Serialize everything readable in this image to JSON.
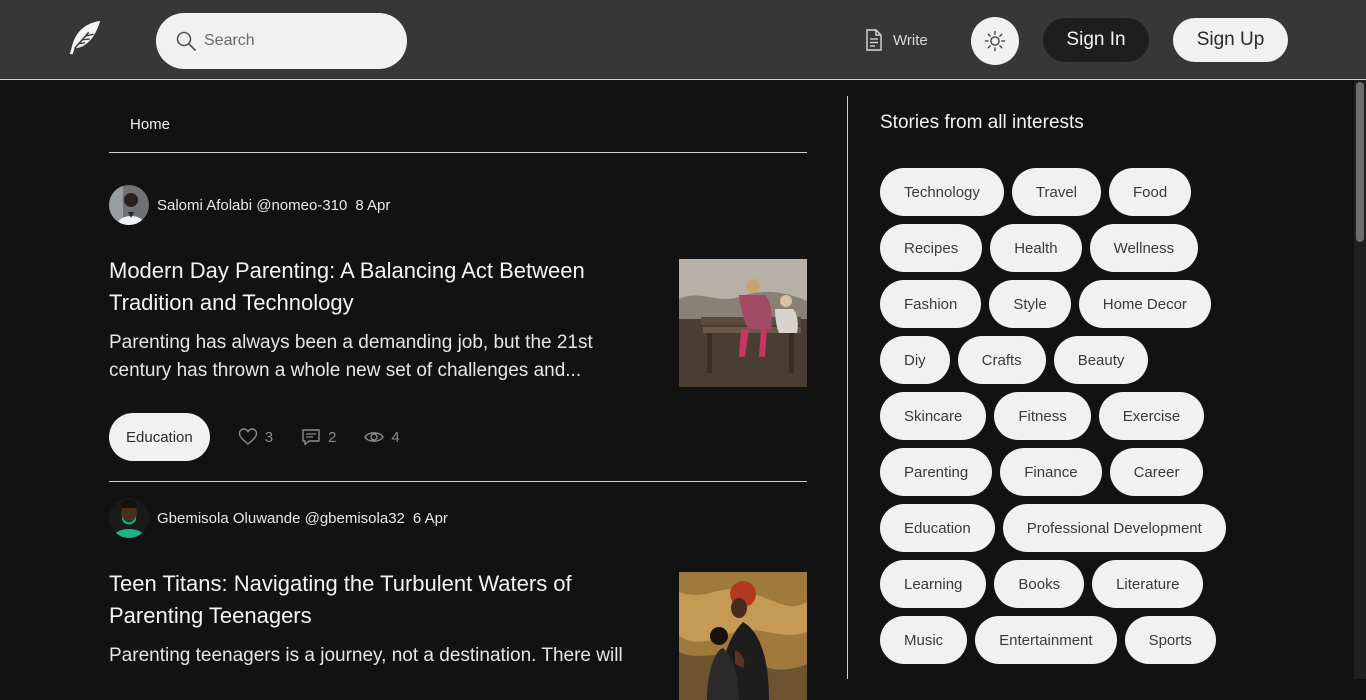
{
  "header": {
    "logo_icon": "feather-icon",
    "search_placeholder": "Search",
    "write_label": "Write",
    "theme_icon": "sun-icon",
    "signin_label": "Sign In",
    "signup_label": "Sign Up"
  },
  "tabs": [
    {
      "label": "Home"
    }
  ],
  "articles": [
    {
      "author": "Salomi Afolabi",
      "handle": "@nomeo-310",
      "date": "8 Apr",
      "title": "Modern Day Parenting: A Balancing Act Between Tradition and Technology",
      "excerpt": "Parenting has always been a demanding job, but the 21st century has thrown a whole new set of challenges and...",
      "topic": "Education",
      "likes": "3",
      "comments": "2",
      "views": "4"
    },
    {
      "author": "Gbemisola Oluwande",
      "handle": "@gbemisola32",
      "date": "6 Apr",
      "title": "Teen Titans: Navigating the Turbulent Waters of Parenting Teenagers",
      "excerpt": "Parenting teenagers is a journey, not a destination. There will"
    }
  ],
  "sidebar": {
    "title": "Stories from all interests",
    "interests": [
      "Technology",
      "Travel",
      "Food",
      "Recipes",
      "Health",
      "Wellness",
      "Fashion",
      "Style",
      "Home Decor",
      "Diy",
      "Crafts",
      "Beauty",
      "Skincare",
      "Fitness",
      "Exercise",
      "Parenting",
      "Finance",
      "Career",
      "Education",
      "Professional Development",
      "Learning",
      "Books",
      "Literature",
      "Music",
      "Entertainment",
      "Sports"
    ]
  }
}
